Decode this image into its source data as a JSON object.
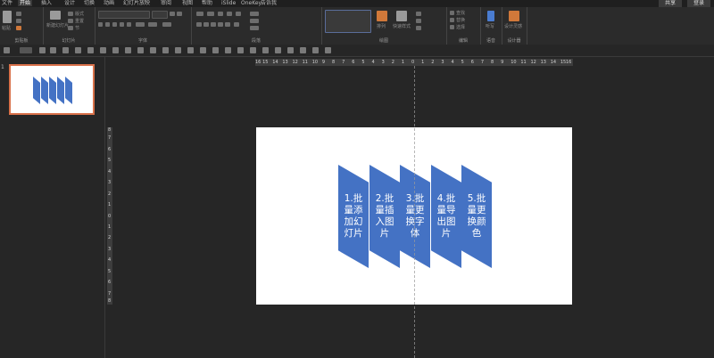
{
  "menu": {
    "tabs": [
      "文件",
      "开始",
      "插入",
      "设计",
      "切换",
      "动画",
      "幻灯片放映",
      "审阅",
      "视图",
      "帮助",
      "iSlide",
      "OneKey",
      "告诉我"
    ],
    "active_index": 1,
    "share": "共享",
    "account": "登录"
  },
  "ribbon": {
    "groups": [
      "剪贴板",
      "幻灯片",
      "字体",
      "段落",
      "绘图",
      "编辑",
      "语音",
      "设计器"
    ],
    "paste_label": "粘贴",
    "new_slide_label": "新建幻灯片",
    "layout_label": "版式",
    "reset_label": "重置",
    "section_label": "节",
    "arrange_label": "排列",
    "quick_styles_label": "快速样式",
    "find_label": "查找",
    "replace_label": "替换",
    "select_label": "选择",
    "dictate_label": "听写",
    "design_ideas_label": "设计灵感"
  },
  "thumbnail": {
    "number": "1"
  },
  "ruler": {
    "h_ticks": [
      "16",
      "15",
      "14",
      "13",
      "12",
      "11",
      "10",
      "9",
      "8",
      "7",
      "6",
      "5",
      "4",
      "3",
      "2",
      "1",
      "0",
      "1",
      "2",
      "3",
      "4",
      "5",
      "6",
      "7",
      "8",
      "9",
      "10",
      "11",
      "12",
      "13",
      "14",
      "15",
      "16"
    ],
    "v_ticks": [
      "8",
      "7",
      "6",
      "5",
      "4",
      "3",
      "2",
      "1",
      "0",
      "1",
      "2",
      "3",
      "4",
      "5",
      "6",
      "7",
      "8"
    ]
  },
  "slide": {
    "shapes": [
      {
        "text": "1.批量添加幻灯片"
      },
      {
        "text": "2.批量插入图片"
      },
      {
        "text": "3.批量更换字体"
      },
      {
        "text": "4.批量导出图片"
      },
      {
        "text": "5.批量更换颜色"
      }
    ]
  },
  "colors": {
    "shape_fill": "#4472c4",
    "selected_border": "#d9714a"
  }
}
